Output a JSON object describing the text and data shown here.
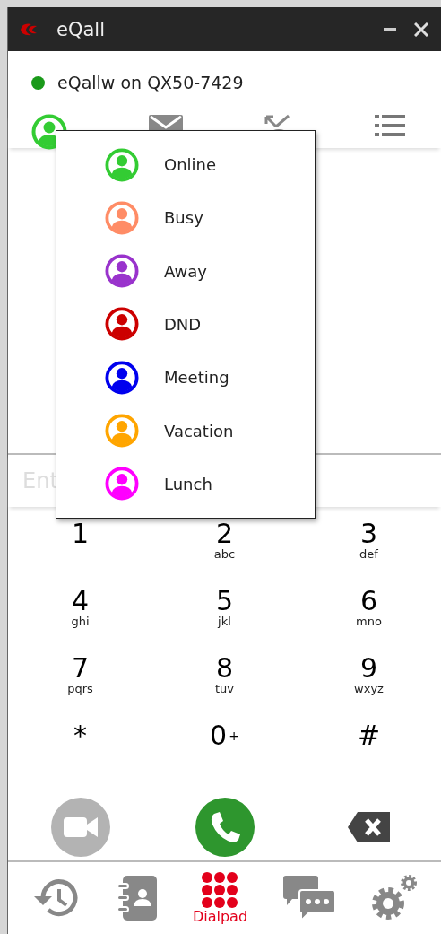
{
  "window": {
    "title": "eQall"
  },
  "status": {
    "text": "eQallw on QX50-7429",
    "color": "#1a9a1a"
  },
  "toolbar": [
    {
      "kind": "presence",
      "color": "#33cc33"
    },
    {
      "kind": "mail"
    },
    {
      "kind": "missed"
    },
    {
      "kind": "list"
    }
  ],
  "presence_menu": [
    {
      "label": "Online",
      "color": "#33cc33"
    },
    {
      "label": "Busy",
      "color": "#ff8c66"
    },
    {
      "label": "Away",
      "color": "#9933cc"
    },
    {
      "label": "DND",
      "color": "#cc0000"
    },
    {
      "label": "Meeting",
      "color": "#0000ee"
    },
    {
      "label": "Vacation",
      "color": "#ffa500"
    },
    {
      "label": "Lunch",
      "color": "#ff00ff"
    }
  ],
  "number_field": {
    "placeholder": "Ent"
  },
  "keypad": [
    {
      "digit": "1"
    },
    {
      "digit": "2",
      "letters": "abc"
    },
    {
      "digit": "3",
      "letters": "def"
    },
    {
      "digit": "4",
      "letters": "ghi"
    },
    {
      "digit": "5",
      "letters": "jkl"
    },
    {
      "digit": "6",
      "letters": "mno"
    },
    {
      "digit": "7",
      "letters": "pqrs"
    },
    {
      "digit": "8",
      "letters": "tuv"
    },
    {
      "digit": "9",
      "letters": "wxyz"
    },
    {
      "digit": "*"
    },
    {
      "digit": "0",
      "extra": "+"
    },
    {
      "digit": "#"
    }
  ],
  "actions": [
    {
      "kind": "video",
      "disabled": true
    },
    {
      "kind": "call",
      "disabled": false
    },
    {
      "kind": "backspace",
      "disabled": false
    }
  ],
  "nav": [
    {
      "kind": "history",
      "selected": false
    },
    {
      "kind": "contacts",
      "selected": false
    },
    {
      "kind": "dialpad",
      "label": "Dialpad",
      "selected": true
    },
    {
      "kind": "chat",
      "selected": false
    },
    {
      "kind": "settings",
      "selected": false
    }
  ]
}
